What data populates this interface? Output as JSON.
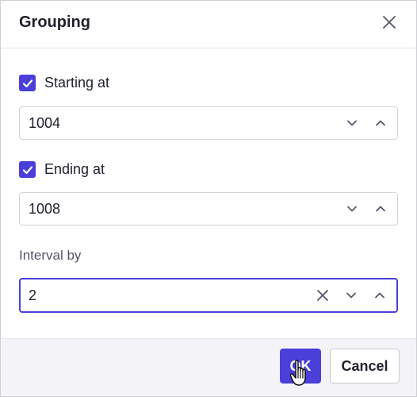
{
  "dialog": {
    "title": "Grouping"
  },
  "starting": {
    "checked": true,
    "label": "Starting at",
    "value": "1004"
  },
  "ending": {
    "checked": true,
    "label": "Ending at",
    "value": "1008"
  },
  "interval": {
    "label": "Interval by",
    "value": "2"
  },
  "footer": {
    "ok_label": "OK",
    "cancel_label": "Cancel"
  },
  "colors": {
    "accent": "#4a3fd9",
    "footer_bg": "#f4f4f7"
  },
  "icons": [
    "close-icon",
    "check-icon",
    "chevron-down-icon",
    "chevron-up-icon",
    "clear-icon",
    "hand-cursor-icon"
  ]
}
